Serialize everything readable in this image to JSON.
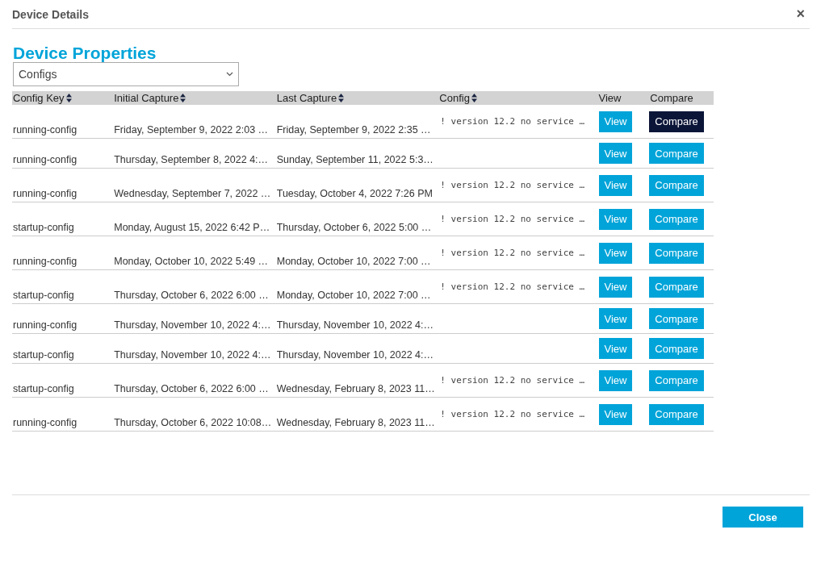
{
  "dialog": {
    "title": "Device Details",
    "close_icon": "×"
  },
  "heading": "Device Properties",
  "dropdown": {
    "value": "Configs"
  },
  "table": {
    "columns": [
      {
        "label": "Config Key",
        "sortable": true
      },
      {
        "label": "Initial Capture",
        "sortable": true
      },
      {
        "label": "Last Capture",
        "sortable": true
      },
      {
        "label": "Config",
        "sortable": true
      },
      {
        "label": "View",
        "sortable": false
      },
      {
        "label": "Compare",
        "sortable": false
      }
    ],
    "rows": [
      {
        "config_key": "running-config",
        "initial_capture": "Friday, September 9, 2022 2:03 …",
        "last_capture": "Friday, September 9, 2022 2:35 …",
        "config": "! version 12.2 no service …",
        "view": "View",
        "compare": "Compare",
        "compare_selected": true
      },
      {
        "config_key": "running-config",
        "initial_capture": "Thursday, September 8, 2022 4:…",
        "last_capture": "Sunday, September 11, 2022 5:3…",
        "view": "View",
        "compare": "Compare",
        "compare_selected": false
      },
      {
        "config_key": "running-config",
        "initial_capture": "Wednesday, September 7, 2022 …",
        "last_capture": "Tuesday, October 4, 2022 7:26 PM",
        "config": "! version 12.2 no service …",
        "view": "View",
        "compare": "Compare",
        "compare_selected": false
      },
      {
        "config_key": "startup-config",
        "initial_capture": "Monday, August 15, 2022 6:42 P…",
        "last_capture": "Thursday, October 6, 2022 5:00 …",
        "config": "! version 12.2 no service …",
        "view": "View",
        "compare": "Compare",
        "compare_selected": false
      },
      {
        "config_key": "running-config",
        "initial_capture": "Monday, October 10, 2022 5:49 …",
        "last_capture": "Monday, October 10, 2022 7:00 …",
        "config": "! version 12.2 no service …",
        "view": "View",
        "compare": "Compare",
        "compare_selected": false
      },
      {
        "config_key": "startup-config",
        "initial_capture": "Thursday, October 6, 2022 6:00 …",
        "last_capture": "Monday, October 10, 2022 7:00 …",
        "config": "! version 12.2 no service …",
        "view": "View",
        "compare": "Compare",
        "compare_selected": false
      },
      {
        "config_key": "running-config",
        "initial_capture": "Thursday, November 10, 2022 4:…",
        "last_capture": "Thursday, November 10, 2022 4:…",
        "view": "View",
        "compare": "Compare",
        "compare_selected": false
      },
      {
        "config_key": "startup-config",
        "initial_capture": "Thursday, November 10, 2022 4:…",
        "last_capture": "Thursday, November 10, 2022 4:…",
        "view": "View",
        "compare": "Compare",
        "compare_selected": false
      },
      {
        "config_key": "startup-config",
        "initial_capture": "Thursday, October 6, 2022 6:00 …",
        "last_capture": "Wednesday, February 8, 2023 11…",
        "config": "! version 12.2 no service …",
        "view": "View",
        "compare": "Compare",
        "compare_selected": false
      },
      {
        "config_key": "running-config",
        "initial_capture": "Thursday, October 6, 2022 10:08…",
        "last_capture": "Wednesday, February 8, 2023 11…",
        "config": "! version 12.2 no service …",
        "view": "View",
        "compare": "Compare",
        "compare_selected": false
      }
    ]
  },
  "footer": {
    "close_button": "Close"
  }
}
